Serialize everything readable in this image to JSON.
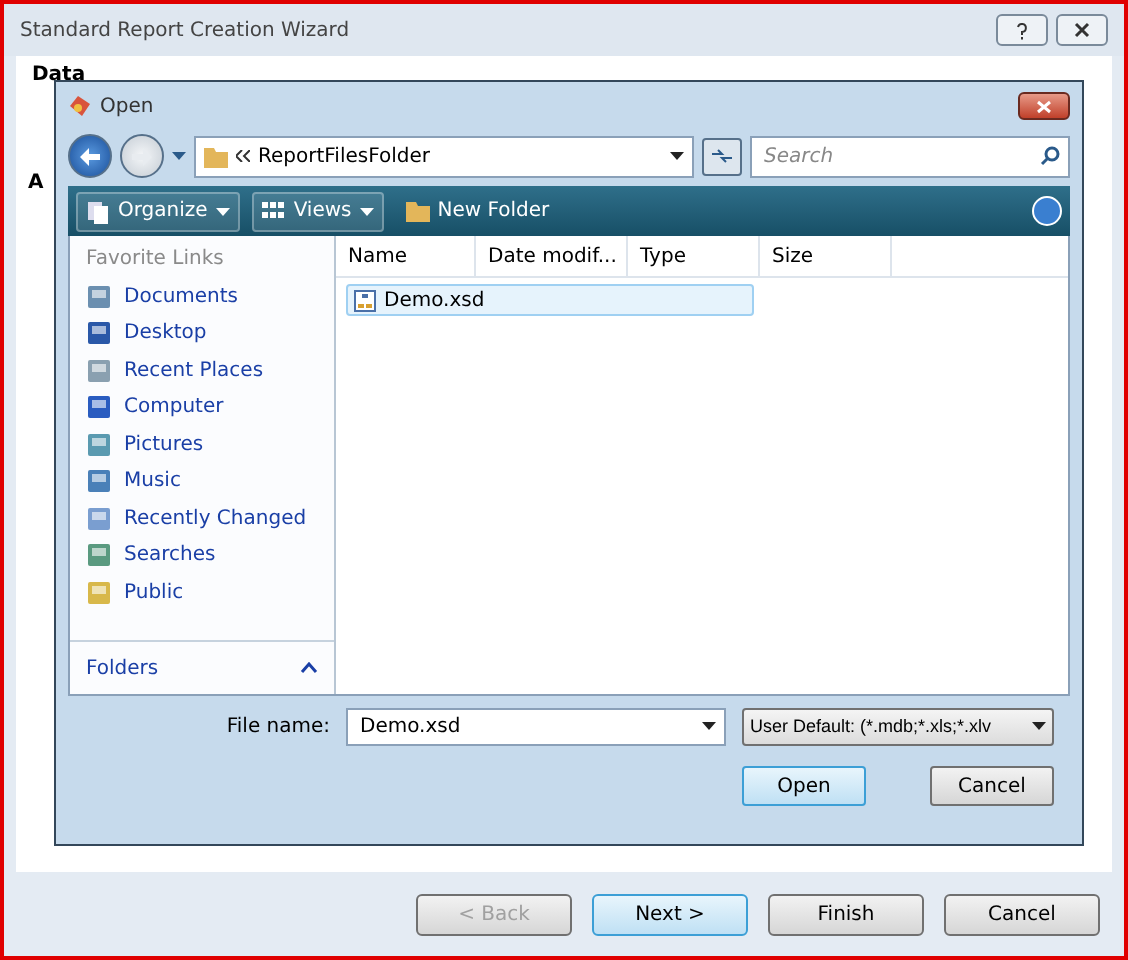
{
  "wizard": {
    "title": "Standard Report Creation Wizard",
    "section": "Data",
    "partial_label": "A",
    "buttons": [
      {
        "label": "< Back",
        "disabled": true,
        "selected": false
      },
      {
        "label": "Next >",
        "disabled": false,
        "selected": true
      },
      {
        "label": "Finish",
        "disabled": false,
        "selected": false
      },
      {
        "label": "Cancel",
        "disabled": false,
        "selected": false
      }
    ]
  },
  "open_dialog": {
    "title": "Open",
    "path": "ReportFilesFolder",
    "search": {
      "placeholder": "Search"
    },
    "toolbar": [
      {
        "label": "Organize",
        "kind": "menu"
      },
      {
        "label": "Views",
        "kind": "menu"
      },
      {
        "label": "New Folder",
        "kind": "button"
      }
    ],
    "favorite_links": {
      "header": "Favorite Links",
      "items": [
        "Documents",
        "Desktop",
        "Recent Places",
        "Computer",
        "Pictures",
        "Music",
        "Recently Changed",
        "Searches",
        "Public"
      ]
    },
    "folders": "Folders",
    "columns": [
      "Name",
      "Date modif...",
      "Type",
      "Size"
    ],
    "files": [
      {
        "name": "Demo.xsd",
        "selected": true
      }
    ],
    "file_name": {
      "label": "File name:",
      "value": "Demo.xsd"
    },
    "filter": "User Default: (*.mdb;*.xls;*.xlv",
    "buttons": [
      {
        "label": "Open",
        "selected": true
      },
      {
        "label": "Cancel",
        "selected": false
      }
    ]
  }
}
